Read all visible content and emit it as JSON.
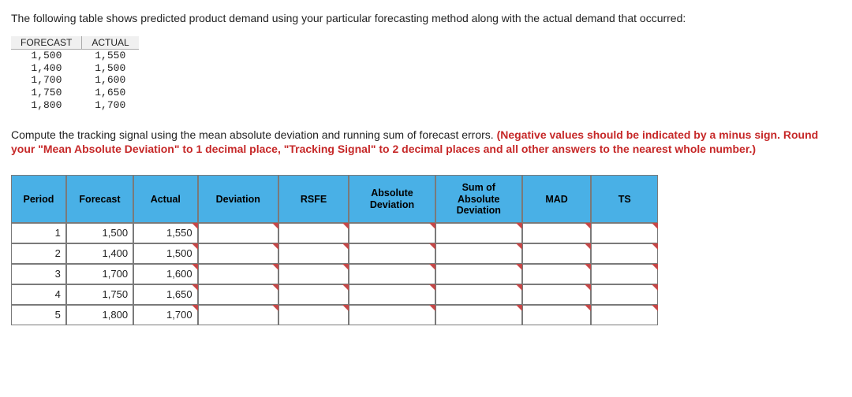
{
  "intro": "The following table shows predicted product demand using your particular forecasting method along with the actual demand that occurred:",
  "forecast_actual": {
    "headers": {
      "forecast": "FORECAST",
      "actual": "ACTUAL"
    },
    "rows": [
      {
        "forecast": "1,500",
        "actual": "1,550"
      },
      {
        "forecast": "1,400",
        "actual": "1,500"
      },
      {
        "forecast": "1,700",
        "actual": "1,600"
      },
      {
        "forecast": "1,750",
        "actual": "1,650"
      },
      {
        "forecast": "1,800",
        "actual": "1,700"
      }
    ]
  },
  "instruction_plain": "Compute the tracking signal using the mean absolute deviation and running sum of forecast errors. ",
  "instruction_bold": "(Negative values should be indicated by a minus sign. Round your \"Mean Absolute Deviation\" to 1 decimal place, \"Tracking Signal\" to 2 decimal places and all other answers to the nearest whole number.)",
  "answers": {
    "headers": {
      "period": "Period",
      "forecast": "Forecast",
      "actual": "Actual",
      "deviation": "Deviation",
      "rsfe": "RSFE",
      "absdev": "Absolute Deviation",
      "sad": "Sum of Absolute Deviation",
      "mad": "MAD",
      "ts": "TS"
    },
    "rows": [
      {
        "period": "1",
        "forecast": "1,500",
        "actual": "1,550"
      },
      {
        "period": "2",
        "forecast": "1,400",
        "actual": "1,500"
      },
      {
        "period": "3",
        "forecast": "1,700",
        "actual": "1,600"
      },
      {
        "period": "4",
        "forecast": "1,750",
        "actual": "1,650"
      },
      {
        "period": "5",
        "forecast": "1,800",
        "actual": "1,700"
      }
    ]
  },
  "chart_data": {
    "type": "table",
    "title": "Forecast vs Actual Demand with Tracking Signal Columns",
    "columns": [
      "Period",
      "Forecast",
      "Actual",
      "Deviation",
      "RSFE",
      "Absolute Deviation",
      "Sum of Absolute Deviation",
      "MAD",
      "TS"
    ],
    "rows": [
      [
        1,
        1500,
        1550,
        null,
        null,
        null,
        null,
        null,
        null
      ],
      [
        2,
        1400,
        1500,
        null,
        null,
        null,
        null,
        null,
        null
      ],
      [
        3,
        1700,
        1600,
        null,
        null,
        null,
        null,
        null,
        null
      ],
      [
        4,
        1750,
        1650,
        null,
        null,
        null,
        null,
        null,
        null
      ],
      [
        5,
        1800,
        1700,
        null,
        null,
        null,
        null,
        null,
        null
      ]
    ]
  }
}
